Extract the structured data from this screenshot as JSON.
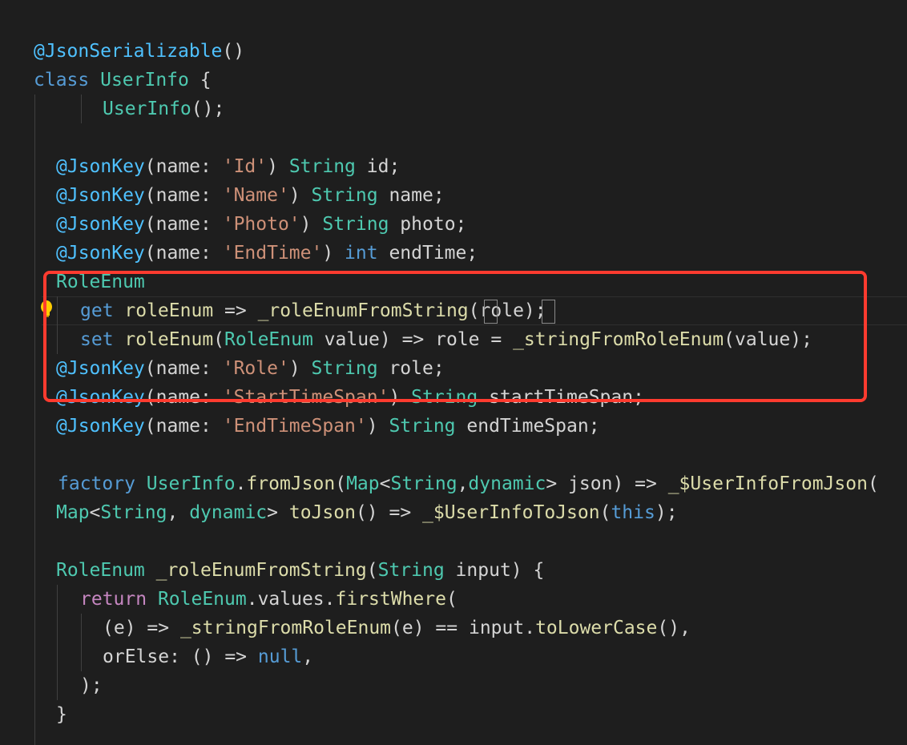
{
  "colors": {
    "background": "#1e1e1e",
    "decorator": "#4fc1ff",
    "keyword": "#569cd6",
    "type": "#4ec9b0",
    "function": "#dcdcaa",
    "string": "#ce9178",
    "variable": "#9cdcfe",
    "control": "#c586c0",
    "plain": "#d4d4d4",
    "annotation_box": "#ff3b2f"
  },
  "icons": {
    "lightbulb": "lightbulb-icon"
  },
  "code": {
    "lines": [
      {
        "name": "line-annotation-serializable",
        "tokens": [
          {
            "t": "@JsonSerializable",
            "c": "dec"
          },
          {
            "t": "()",
            "c": "plain"
          }
        ]
      },
      {
        "name": "line-class-decl",
        "tokens": [
          {
            "t": "class ",
            "c": "kw"
          },
          {
            "t": "UserInfo",
            "c": "type"
          },
          {
            "t": " {",
            "c": "plain"
          }
        ]
      },
      {
        "name": "line-constructor",
        "tokens": [
          {
            "t": "UserInfo",
            "c": "type"
          },
          {
            "t": "();",
            "c": "plain"
          }
        ]
      },
      {
        "name": "line-field-id",
        "tokens": [
          {
            "t": "@JsonKey",
            "c": "dec"
          },
          {
            "t": "(name: ",
            "c": "plain"
          },
          {
            "t": "'Id'",
            "c": "str"
          },
          {
            "t": ") ",
            "c": "plain"
          },
          {
            "t": "String",
            "c": "type"
          },
          {
            "t": " id;",
            "c": "plain"
          }
        ]
      },
      {
        "name": "line-field-name",
        "tokens": [
          {
            "t": "@JsonKey",
            "c": "dec"
          },
          {
            "t": "(name: ",
            "c": "plain"
          },
          {
            "t": "'Name'",
            "c": "str"
          },
          {
            "t": ") ",
            "c": "plain"
          },
          {
            "t": "String",
            "c": "type"
          },
          {
            "t": " name;",
            "c": "plain"
          }
        ]
      },
      {
        "name": "line-field-photo",
        "tokens": [
          {
            "t": "@JsonKey",
            "c": "dec"
          },
          {
            "t": "(name: ",
            "c": "plain"
          },
          {
            "t": "'Photo'",
            "c": "str"
          },
          {
            "t": ") ",
            "c": "plain"
          },
          {
            "t": "String",
            "c": "type"
          },
          {
            "t": " photo;",
            "c": "plain"
          }
        ]
      },
      {
        "name": "line-field-endtime",
        "tokens": [
          {
            "t": "@JsonKey",
            "c": "dec"
          },
          {
            "t": "(name: ",
            "c": "plain"
          },
          {
            "t": "'EndTime'",
            "c": "str"
          },
          {
            "t": ") ",
            "c": "plain"
          },
          {
            "t": "int",
            "c": "kw"
          },
          {
            "t": " endTime;",
            "c": "plain"
          }
        ]
      },
      {
        "name": "line-roleenum-type",
        "tokens": [
          {
            "t": "RoleEnum",
            "c": "type"
          }
        ]
      },
      {
        "name": "line-roleenum-getter",
        "tokens": [
          {
            "t": "get ",
            "c": "kw"
          },
          {
            "t": "roleEnum",
            "c": "fn"
          },
          {
            "t": " => ",
            "c": "plain"
          },
          {
            "t": "_roleEnumFromString",
            "c": "fn"
          },
          {
            "t": "(",
            "c": "plain"
          },
          {
            "t": "role",
            "c": "plain"
          },
          {
            "t": ")",
            "c": "plain"
          },
          {
            "t": ";",
            "c": "plain"
          }
        ]
      },
      {
        "name": "line-roleenum-setter",
        "tokens": [
          {
            "t": "set ",
            "c": "kw"
          },
          {
            "t": "roleEnum",
            "c": "fn"
          },
          {
            "t": "(",
            "c": "plain"
          },
          {
            "t": "RoleEnum",
            "c": "type"
          },
          {
            "t": " value) => role = ",
            "c": "plain"
          },
          {
            "t": "_stringFromRoleEnum",
            "c": "fn"
          },
          {
            "t": "(value);",
            "c": "plain"
          }
        ]
      },
      {
        "name": "line-field-role",
        "tokens": [
          {
            "t": "@JsonKey",
            "c": "dec"
          },
          {
            "t": "(name: ",
            "c": "plain"
          },
          {
            "t": "'Role'",
            "c": "str"
          },
          {
            "t": ") ",
            "c": "plain"
          },
          {
            "t": "String",
            "c": "type"
          },
          {
            "t": " role;",
            "c": "plain"
          }
        ]
      },
      {
        "name": "line-field-starttimespan",
        "tokens": [
          {
            "t": "@JsonKey",
            "c": "dec"
          },
          {
            "t": "(name: ",
            "c": "plain"
          },
          {
            "t": "'StartTimeSpan'",
            "c": "str"
          },
          {
            "t": ") ",
            "c": "plain"
          },
          {
            "t": "String",
            "c": "type"
          },
          {
            "t": " startTimeSpan;",
            "c": "plain"
          }
        ]
      },
      {
        "name": "line-field-endtimespan",
        "tokens": [
          {
            "t": "@JsonKey",
            "c": "dec"
          },
          {
            "t": "(name: ",
            "c": "plain"
          },
          {
            "t": "'EndTimeSpan'",
            "c": "str"
          },
          {
            "t": ") ",
            "c": "plain"
          },
          {
            "t": "String",
            "c": "type"
          },
          {
            "t": " endTimeSpan;",
            "c": "plain"
          }
        ]
      },
      {
        "name": "line-factory-fromjson",
        "tokens": [
          {
            "t": "factory ",
            "c": "kw"
          },
          {
            "t": "UserInfo",
            "c": "type"
          },
          {
            "t": ".",
            "c": "plain"
          },
          {
            "t": "fromJson",
            "c": "fn"
          },
          {
            "t": "(",
            "c": "plain"
          },
          {
            "t": "Map",
            "c": "type"
          },
          {
            "t": "<",
            "c": "plain"
          },
          {
            "t": "String",
            "c": "type"
          },
          {
            "t": ",",
            "c": "plain"
          },
          {
            "t": "dynamic",
            "c": "type"
          },
          {
            "t": "> json) => ",
            "c": "plain"
          },
          {
            "t": "_$UserInfoFromJson",
            "c": "fn"
          },
          {
            "t": "(",
            "c": "plain"
          }
        ]
      },
      {
        "name": "line-tojson",
        "tokens": [
          {
            "t": "Map",
            "c": "type"
          },
          {
            "t": "<",
            "c": "plain"
          },
          {
            "t": "String",
            "c": "type"
          },
          {
            "t": ", ",
            "c": "plain"
          },
          {
            "t": "dynamic",
            "c": "type"
          },
          {
            "t": "> ",
            "c": "plain"
          },
          {
            "t": "toJson",
            "c": "fn"
          },
          {
            "t": "() => ",
            "c": "plain"
          },
          {
            "t": "_$UserInfoToJson",
            "c": "fn"
          },
          {
            "t": "(",
            "c": "plain"
          },
          {
            "t": "this",
            "c": "kw"
          },
          {
            "t": ");",
            "c": "plain"
          }
        ]
      },
      {
        "name": "line-method-rolefromstring",
        "tokens": [
          {
            "t": "RoleEnum",
            "c": "type"
          },
          {
            "t": " ",
            "c": "plain"
          },
          {
            "t": "_roleEnumFromString",
            "c": "fn"
          },
          {
            "t": "(",
            "c": "plain"
          },
          {
            "t": "String",
            "c": "type"
          },
          {
            "t": " input) {",
            "c": "plain"
          }
        ]
      },
      {
        "name": "line-return",
        "tokens": [
          {
            "t": "return ",
            "c": "ctrl"
          },
          {
            "t": "RoleEnum",
            "c": "type"
          },
          {
            "t": ".values.",
            "c": "plain"
          },
          {
            "t": "firstWhere",
            "c": "fn"
          },
          {
            "t": "(",
            "c": "plain"
          }
        ]
      },
      {
        "name": "line-lambda",
        "tokens": [
          {
            "t": "(e) => ",
            "c": "plain"
          },
          {
            "t": "_stringFromRoleEnum",
            "c": "fn"
          },
          {
            "t": "(e) == input.",
            "c": "plain"
          },
          {
            "t": "toLowerCase",
            "c": "fn"
          },
          {
            "t": "(),",
            "c": "plain"
          }
        ]
      },
      {
        "name": "line-orelse",
        "tokens": [
          {
            "t": "orElse: () => ",
            "c": "plain"
          },
          {
            "t": "null",
            "c": "kw"
          },
          {
            "t": ",",
            "c": "plain"
          }
        ]
      },
      {
        "name": "line-close-call",
        "tokens": [
          {
            "t": ");",
            "c": "plain"
          }
        ]
      },
      {
        "name": "line-close-method",
        "tokens": [
          {
            "t": "}",
            "c": "plain"
          }
        ]
      }
    ]
  }
}
